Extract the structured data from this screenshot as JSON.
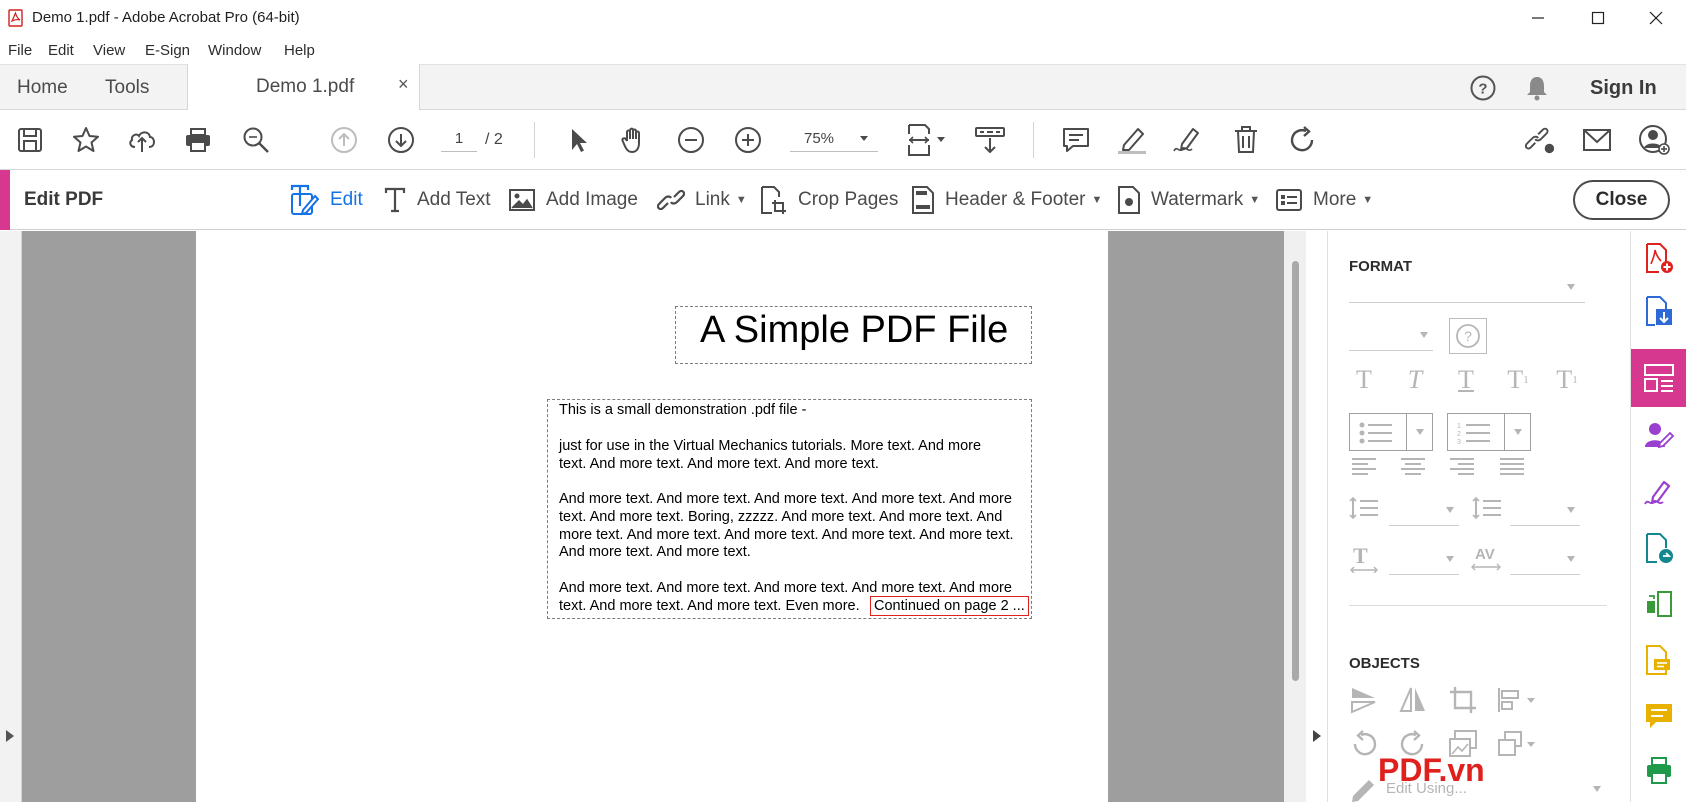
{
  "window": {
    "title": "Demo 1.pdf - Adobe Acrobat Pro (64-bit)",
    "controls": [
      "minimize",
      "maximize",
      "close"
    ]
  },
  "menu": [
    "File",
    "Edit",
    "View",
    "E-Sign",
    "Window",
    "Help"
  ],
  "tabs": {
    "home": "Home",
    "tools": "Tools",
    "document": "Demo 1.pdf",
    "close_glyph": "×",
    "sign_in": "Sign In"
  },
  "toolbar": {
    "page_current": "1",
    "page_total": "/ 2",
    "zoom": "75%"
  },
  "editbar": {
    "title": "Edit PDF",
    "tools": {
      "edit": "Edit",
      "add_text": "Add Text",
      "add_image": "Add Image",
      "link": "Link",
      "crop_pages": "Crop Pages",
      "header_footer": "Header & Footer",
      "watermark": "Watermark",
      "more": "More"
    },
    "close": "Close"
  },
  "document": {
    "title": "A Simple PDF File",
    "lines": [
      "This is a small demonstration .pdf file -",
      "just for use in the Virtual Mechanics tutorials. More text. And more",
      "text. And more text. And more text. And more text.",
      "And more text. And more text. And more text. And more text. And more",
      "text. And more text. Boring, zzzzz. And more text. And more text. And",
      "more text. And more text. And more text. And more text. And more text.",
      "And more text. And more text.",
      "And more text. And more text. And more text. And more text. And more",
      "text. And more text. And more text. Even more."
    ],
    "continued": "Continued on page 2 ..."
  },
  "format_panel": {
    "format_heading": "FORMAT",
    "objects_heading": "OBJECTS",
    "edit_using": "Edit Using..."
  },
  "watermark_text": "PDF.vn",
  "colors": {
    "accent_pink": "#d6378f",
    "link_blue": "#1473e6",
    "continued_box": "#e0201d"
  }
}
